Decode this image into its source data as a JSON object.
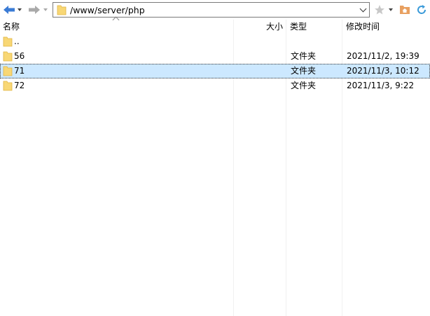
{
  "toolbar": {
    "address": "/www/server/php"
  },
  "columns": {
    "name": "名称",
    "size": "大小",
    "type": "类型",
    "modified": "修改时间"
  },
  "rows": [
    {
      "name": "..",
      "size": "",
      "type": "",
      "modified": "",
      "selected": false
    },
    {
      "name": "56",
      "size": "",
      "type": "文件夹",
      "modified": "2021/11/2, 19:39",
      "selected": false
    },
    {
      "name": "71",
      "size": "",
      "type": "文件夹",
      "modified": "2021/11/3, 10:12",
      "selected": true
    },
    {
      "name": "72",
      "size": "",
      "type": "文件夹",
      "modified": "2021/11/3, 9:22",
      "selected": false
    }
  ],
  "icons": {
    "back": "arrow-left-icon",
    "forward": "arrow-right-icon",
    "folder": "folder-icon",
    "bookmark": "star-icon",
    "home": "home-folder-icon",
    "refresh": "refresh-icon"
  },
  "colors": {
    "selection": "#cce8ff",
    "back_arrow": "#3a7bd5",
    "folder": "#f8d775",
    "home": "#e8a060",
    "refresh": "#3a9ad9"
  }
}
